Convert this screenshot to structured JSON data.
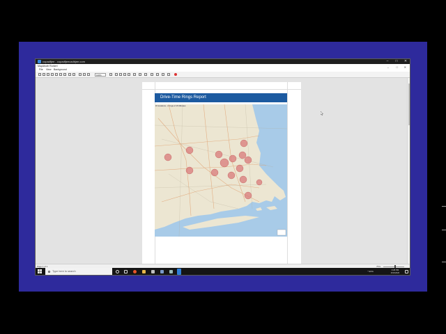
{
  "window": {
    "title": "copadfjee - copadfjeecadbjee.com",
    "controls": [
      "–",
      "□",
      "✕"
    ]
  },
  "menubar": {
    "doc_title": "MapAbuttr Rorkert",
    "items": [
      "File",
      "View",
      "Background"
    ],
    "window_controls": [
      "–",
      "□",
      "✕"
    ]
  },
  "toolbar": {
    "zoom_value": "100%"
  },
  "report": {
    "header_title": "Drive-Time Rings Report",
    "map_subtitle": "15 locations - 2 rings of 15 Minutes"
  },
  "statusbar": {
    "page_info": "Page 1 of 1",
    "zoom_percent": "75%"
  },
  "taskbar": {
    "search_placeholder": "Type here to search",
    "tray_text": "^  ENG",
    "clock_time": "3:28 PM",
    "clock_date": "3/16/2020"
  },
  "colors": {
    "desktop_bg": "#2e2a9c",
    "report_header": "#1c5aa0",
    "water": "#a8cbe8",
    "land": "#ece6d2",
    "ring": "#d97a7a"
  }
}
